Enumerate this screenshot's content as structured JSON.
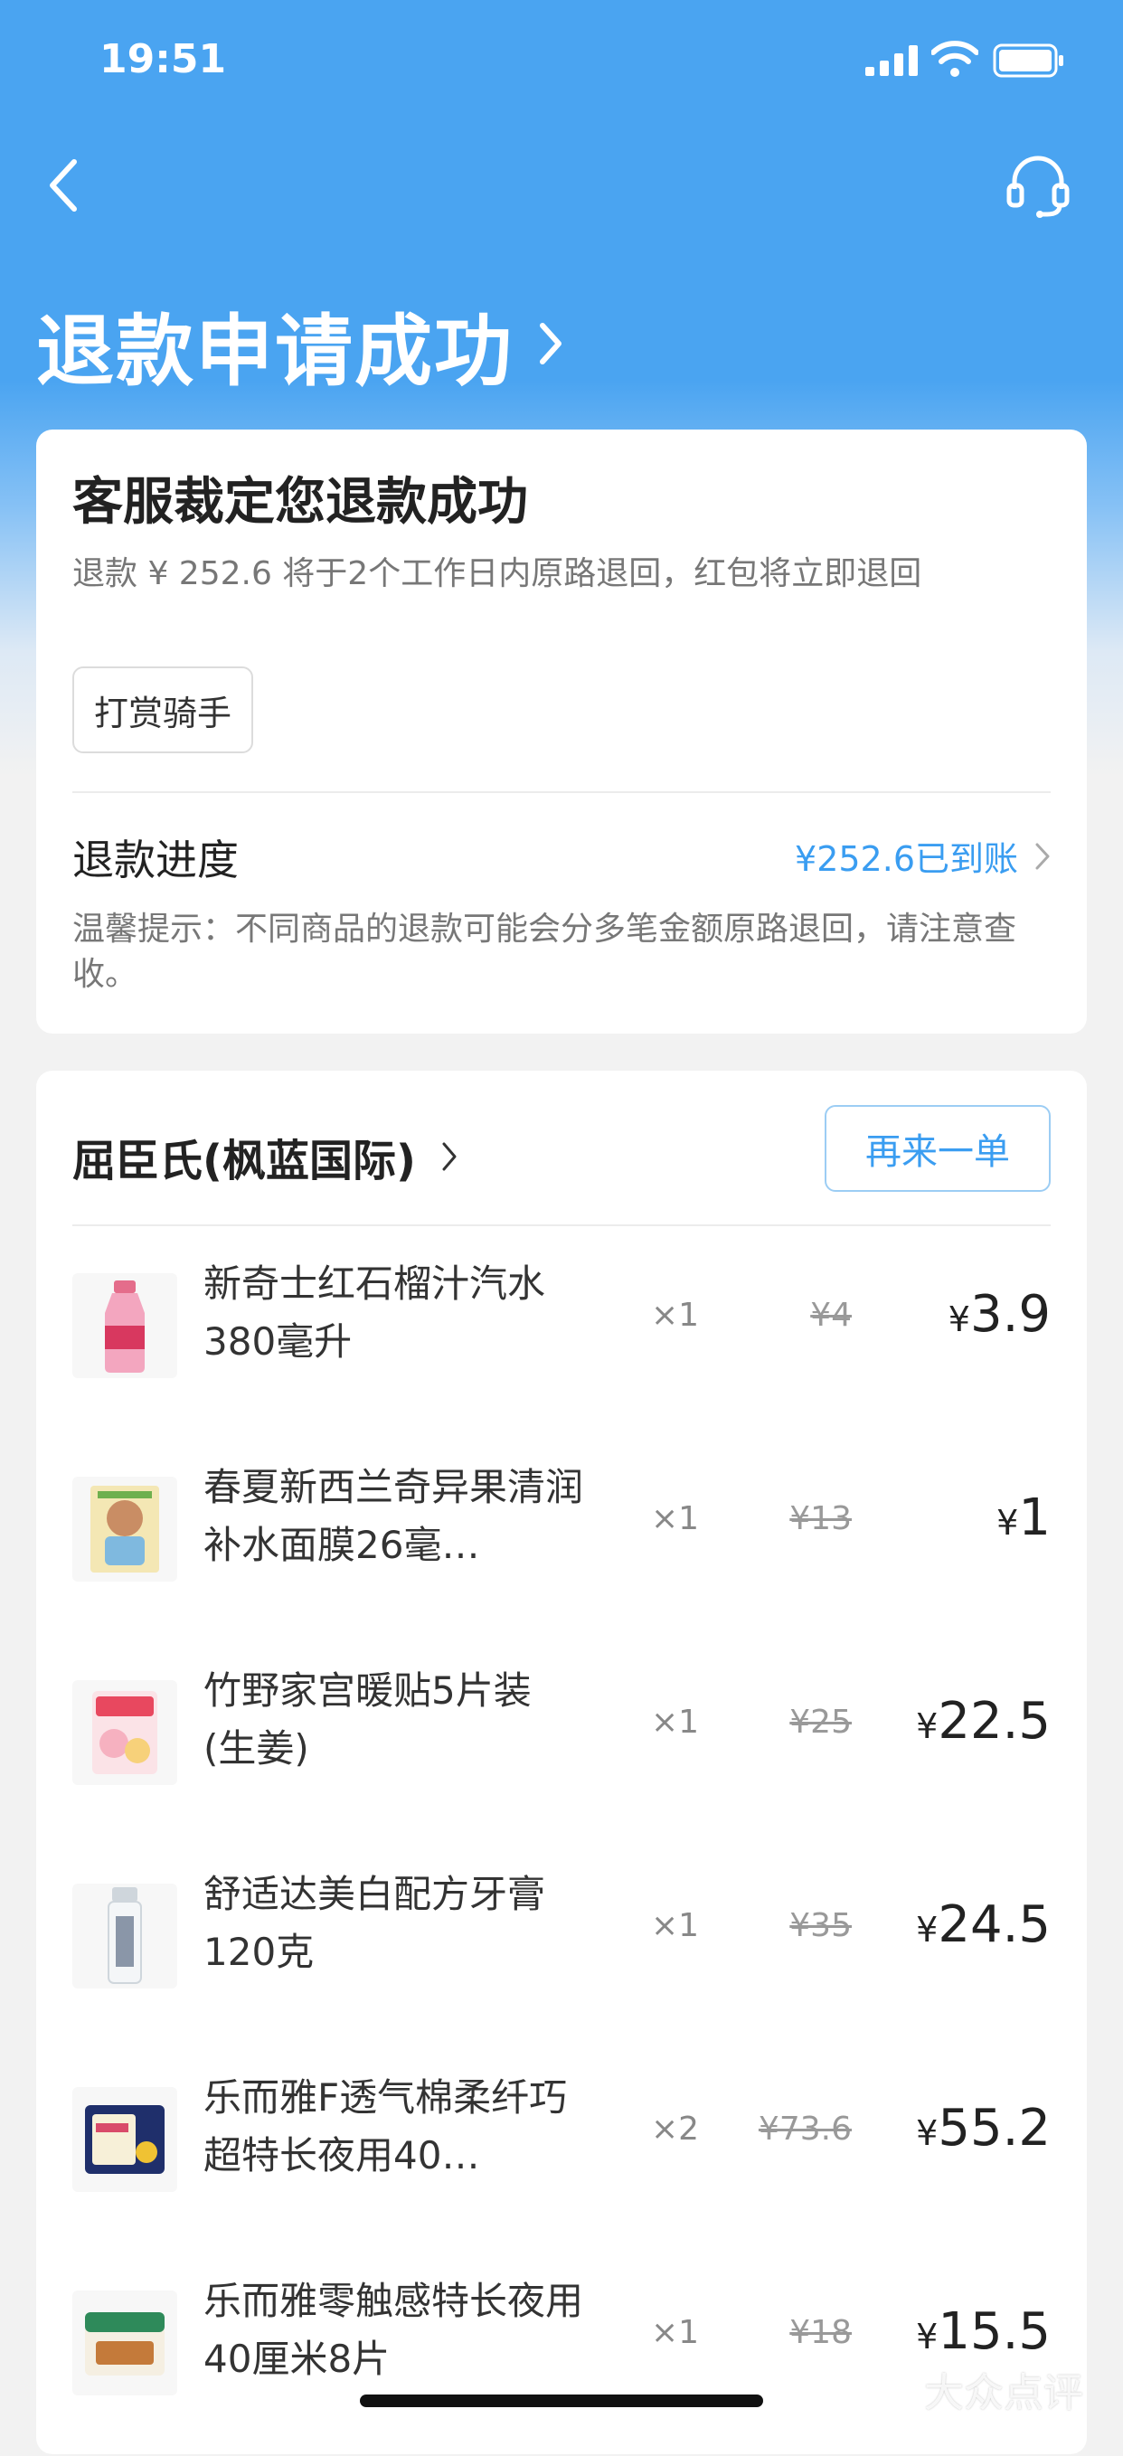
{
  "status_bar": {
    "time": "19:51"
  },
  "header": {
    "title": "退款申请成功"
  },
  "refund_card": {
    "title": "客服裁定您退款成功",
    "subtitle": "退款 ¥ 252.6 将于2个工作日内原路退回，红包将立即退回",
    "reward_button": "打赏骑手",
    "progress_label": "退款进度",
    "progress_amount": "¥252.6已到账",
    "tip": "温馨提示：不同商品的退款可能会分多笔金额原路退回，请注意查收。"
  },
  "order": {
    "shop_name": "屈臣氏(枫蓝国际)",
    "reorder_button": "再来一单",
    "items": [
      {
        "name": "新奇士红石榴汁汽水380毫升",
        "qty": "×1",
        "orig_price": "¥4",
        "price": "3.9",
        "icon": "pink-bottle-thumb"
      },
      {
        "name": "春夏新西兰奇异果清润补水面膜26毫…",
        "qty": "×1",
        "orig_price": "¥13",
        "price": "1",
        "icon": "face-mask-thumb"
      },
      {
        "name": "竹野家宫暖贴5片装(生姜)",
        "qty": "×1",
        "orig_price": "¥25",
        "price": "22.5",
        "icon": "warmer-pack-thumb"
      },
      {
        "name": "舒适达美白配方牙膏120克",
        "qty": "×1",
        "orig_price": "¥35",
        "price": "24.5",
        "icon": "toothpaste-thumb"
      },
      {
        "name": "乐而雅F透气棉柔纤巧超特长夜用40…",
        "qty": "×2",
        "orig_price": "¥73.6",
        "price": "55.2",
        "icon": "pad-pack-thumb"
      },
      {
        "name": "乐而雅零触感特长夜用40厘米8片",
        "qty": "×1",
        "orig_price": "¥18",
        "price": "15.5",
        "icon": "pad-pack-thumb-2"
      }
    ],
    "currency_symbol": "¥"
  },
  "watermark": {
    "text": "大众点评"
  },
  "colors": {
    "header_blue": "#4aa4f1",
    "accent_blue": "#3a9df1"
  }
}
